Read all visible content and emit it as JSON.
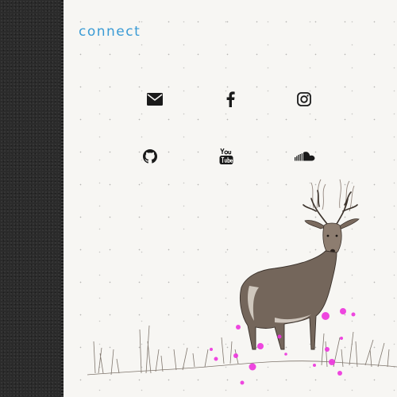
{
  "page": {
    "title": "connect"
  },
  "social_links": [
    {
      "name": "email",
      "icon": "envelope-icon"
    },
    {
      "name": "facebook",
      "icon": "facebook-icon"
    },
    {
      "name": "instagram",
      "icon": "instagram-icon"
    },
    {
      "name": "github",
      "icon": "github-icon"
    },
    {
      "name": "youtube",
      "icon": "youtube-icon"
    },
    {
      "name": "soundcloud",
      "icon": "soundcloud-icon"
    }
  ],
  "colors": {
    "accent": "#3a9bd5",
    "sidebar": "#2b2b2b",
    "background": "#f7f6f3",
    "icon": "#1a1a1a",
    "paint_splatter": "#ee33dd"
  }
}
